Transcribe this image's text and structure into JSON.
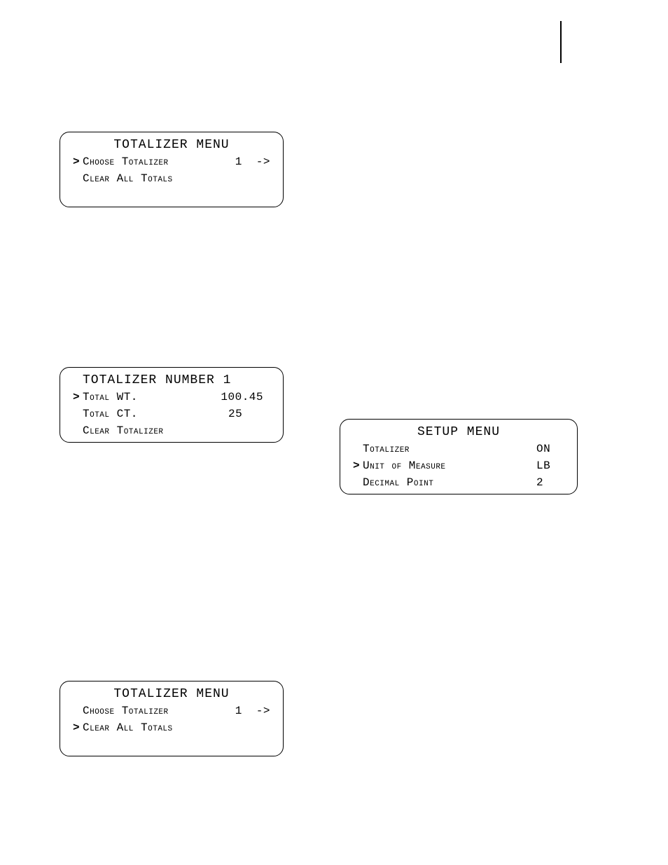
{
  "cursor_glyph": ">",
  "arrow_glyph": "->",
  "panel1": {
    "title": "TOTALIZER MENU",
    "rows": [
      {
        "selected": true,
        "label": "Choose Totalizer",
        "value": "1",
        "has_arrow": true
      },
      {
        "selected": false,
        "label": "Clear All Totals",
        "value": "",
        "has_arrow": false
      }
    ]
  },
  "panel2": {
    "title": "TOTALIZER NUMBER 1",
    "rows": [
      {
        "selected": true,
        "label": "Total WT.",
        "value": "100.45",
        "has_arrow": false
      },
      {
        "selected": false,
        "label": "Total CT.",
        "value": "25",
        "has_arrow": false
      },
      {
        "selected": false,
        "label": "Clear Totalizer",
        "value": "",
        "has_arrow": false
      }
    ]
  },
  "panel3": {
    "title": "SETUP MENU",
    "rows": [
      {
        "selected": false,
        "label": "Totalizer",
        "value": "ON",
        "has_arrow": false
      },
      {
        "selected": true,
        "label": "Unit of Measure",
        "value": "LB",
        "has_arrow": false
      },
      {
        "selected": false,
        "label": "Decimal Point",
        "value": "2",
        "has_arrow": false
      }
    ]
  },
  "panel4": {
    "title": "TOTALIZER MENU",
    "rows": [
      {
        "selected": false,
        "label": "Choose Totalizer",
        "value": "1",
        "has_arrow": true
      },
      {
        "selected": true,
        "label": "Clear All Totals",
        "value": "",
        "has_arrow": false
      }
    ]
  }
}
